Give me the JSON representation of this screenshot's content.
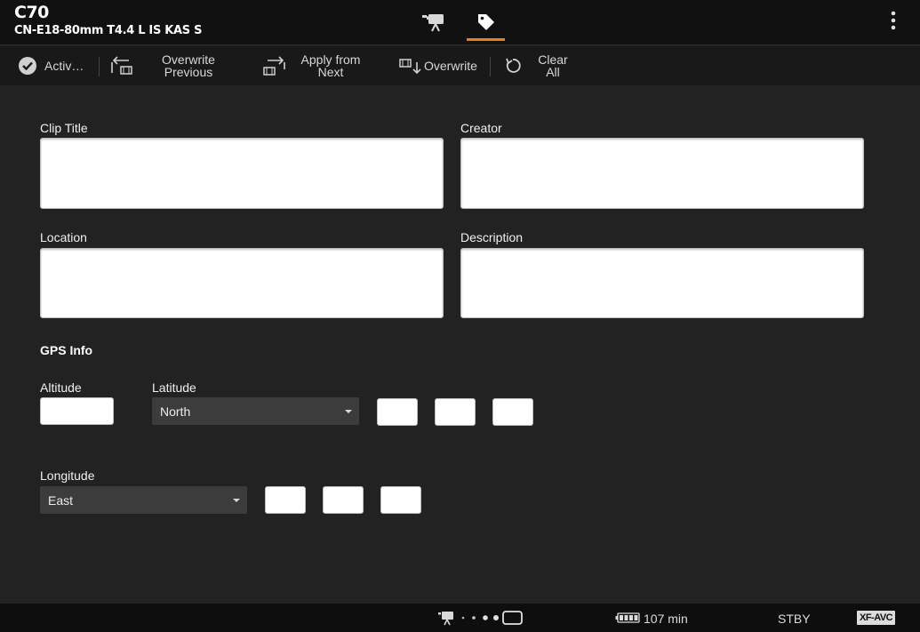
{
  "header": {
    "camera_model": "C70",
    "lens": "CN-E18-80mm T4.4 L IS KAS S",
    "tabs": [
      {
        "icon": "video-camera-icon",
        "active": false
      },
      {
        "icon": "tag-icon",
        "active": true
      }
    ],
    "accent_color": "#e67e22"
  },
  "toolbar": {
    "activate_label": "Activ…",
    "overwrite_previous": {
      "line1": "Overwrite",
      "line2": "Previous"
    },
    "apply_from_next": {
      "line1": "Apply from",
      "line2": "Next"
    },
    "overwrite_label": "Overwrite",
    "clear_all": {
      "line1": "Clear",
      "line2": "All"
    }
  },
  "form": {
    "clip_title_label": "Clip Title",
    "clip_title_value": "",
    "creator_label": "Creator",
    "creator_value": "",
    "location_label": "Location",
    "location_value": "",
    "description_label": "Description",
    "description_value": "",
    "gps_title": "GPS Info",
    "altitude_label": "Altitude",
    "altitude_value": "",
    "latitude_label": "Latitude",
    "latitude_direction": "North",
    "latitude_values": [
      "",
      "",
      ""
    ],
    "longitude_label": "Longitude",
    "longitude_direction": "East",
    "longitude_values": [
      "",
      "",
      ""
    ]
  },
  "status": {
    "battery": "107 min",
    "mode": "STBY",
    "codec": "XF-AVC"
  }
}
